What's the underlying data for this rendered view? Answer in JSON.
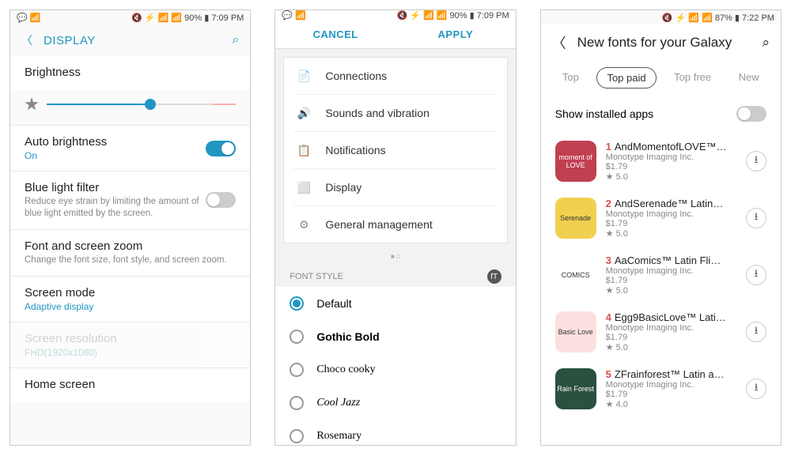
{
  "phone1": {
    "status": {
      "left": "💬 📶",
      "right": "🔇 ⚡ 📶 📶 90% ▮ 7:09 PM"
    },
    "header": {
      "title": "DISPLAY"
    },
    "brightness": {
      "label": "Brightness",
      "fill_pct": 52
    },
    "auto_bright": {
      "label": "Auto brightness",
      "value": "On"
    },
    "blue_light": {
      "label": "Blue light filter",
      "desc": "Reduce eye strain by limiting the amount of blue light emitted by the screen."
    },
    "font_zoom": {
      "label": "Font and screen zoom",
      "desc": "Change the font size, font style, and screen zoom."
    },
    "screen_mode": {
      "label": "Screen mode",
      "value": "Adaptive display"
    },
    "screen_res": {
      "label": "Screen resolution",
      "value": "FHD(1920x1080)"
    },
    "home": {
      "label": "Home screen"
    }
  },
  "phone2": {
    "status": {
      "left": "💬 📶",
      "right": "🔇 ⚡ 📶 📶 90% ▮ 7:09 PM"
    },
    "header": {
      "cancel": "CANCEL",
      "apply": "APPLY"
    },
    "categories": [
      {
        "icon": "📄",
        "color": "#f0a050",
        "label": "Connections"
      },
      {
        "icon": "🔊",
        "color": "#4aa0e0",
        "label": "Sounds and vibration"
      },
      {
        "icon": "📋",
        "color": "#e06050",
        "label": "Notifications"
      },
      {
        "icon": "⬜",
        "color": "#5ab060",
        "label": "Display"
      },
      {
        "icon": "⚙",
        "color": "#888",
        "label": "General management"
      }
    ],
    "font_group": "FONT STYLE",
    "fonts": [
      {
        "label": "Default",
        "selected": true,
        "cls": ""
      },
      {
        "label": "Gothic Bold",
        "selected": false,
        "cls": "f-gothic"
      },
      {
        "label": "Choco cooky",
        "selected": false,
        "cls": "f-choco"
      },
      {
        "label": "Cool Jazz",
        "selected": false,
        "cls": "f-cool"
      },
      {
        "label": "Rosemary",
        "selected": false,
        "cls": "f-rose"
      }
    ]
  },
  "phone3": {
    "status": {
      "left": "",
      "right": "🔇 ⚡ 📶 📶 87% ▮ 7:22 PM"
    },
    "header": {
      "title": "New fonts for your Galaxy"
    },
    "tabs": [
      "Top",
      "Top paid",
      "Top free",
      "New"
    ],
    "tab_selected": 1,
    "show_installed": "Show installed apps",
    "apps": [
      {
        "rank": 1,
        "name": "AndMomentofLOVE™…",
        "pub": "Monotype Imaging Inc.",
        "price": "$1.79",
        "rating": "5.0",
        "bg": "#c04050",
        "txt": "moment of LOVE"
      },
      {
        "rank": 2,
        "name": "AndSerenade™ Latin…",
        "pub": "Monotype Imaging Inc.",
        "price": "$1.79",
        "rating": "5.0",
        "bg": "#f0d050",
        "txt": "Serenade"
      },
      {
        "rank": 3,
        "name": "AaComics™ Latin Fli…",
        "pub": "Monotype Imaging Inc.",
        "price": "$1.79",
        "rating": "5.0",
        "bg": "#fff",
        "txt": "COMICS"
      },
      {
        "rank": 4,
        "name": "Egg9BasicLove™ Lati…",
        "pub": "Monotype Imaging Inc.",
        "price": "$1.79",
        "rating": "5.0",
        "bg": "#fce0e0",
        "txt": "Basic Love"
      },
      {
        "rank": 5,
        "name": "ZFrainforest™ Latin a…",
        "pub": "Monotype Imaging Inc.",
        "price": "$1.79",
        "rating": "4.0",
        "bg": "#2a5040",
        "txt": "Rain Forest"
      }
    ]
  }
}
